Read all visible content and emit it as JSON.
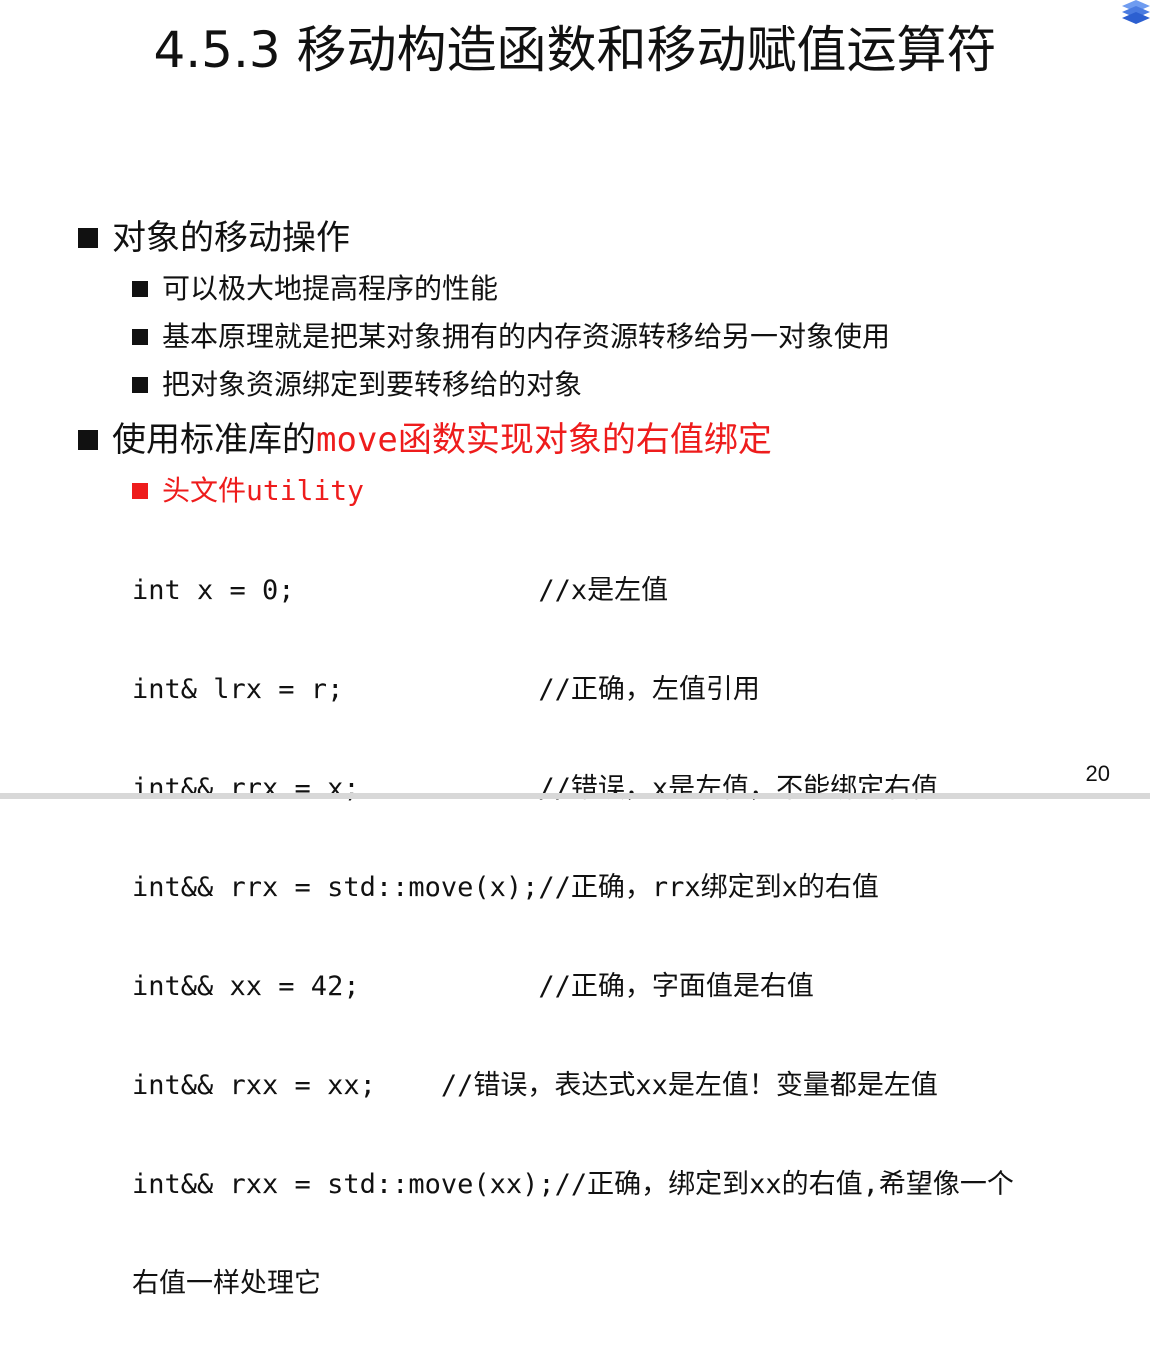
{
  "title": "4.5.3 移动构造函数和移动赋值运算符",
  "bullets": {
    "b1": "对象的移动操作",
    "b1_items": [
      "可以极大地提高程序的性能",
      "基本原理就是把某对象拥有的内存资源转移给另一对象使用",
      "把对象资源绑定到要转移给的对象"
    ],
    "b2_prefix": "使用标准库的",
    "b2_highlight": "move函数实现对象的右值绑定",
    "b2_item": "头文件utility"
  },
  "code_lines": [
    "int x = 0;               //x是左值",
    "int& lrx = r;            //正确，左值引用",
    "int&& rrx = x;           //错误，x是左值，不能绑定右值",
    "int&& rrx = std::move(x);//正确，rrx绑定到x的右值",
    "int&& xx = 42;           //正确，字面值是右值",
    "int&& rxx = xx;    //错误，表达式xx是左值！变量都是左值",
    "int&& rxx = std::move(xx);//正确，绑定到xx的右值,希望像一个",
    "右值一样处理它"
  ],
  "page_number": "20",
  "colors": {
    "accent_red": "#ee1c1c",
    "logo_blue": "#4a7be0"
  },
  "icons": {
    "corner": "layers-logo-icon"
  }
}
